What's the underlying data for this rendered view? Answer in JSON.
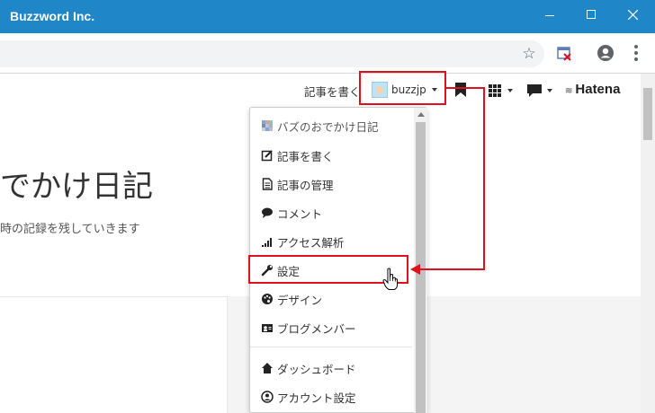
{
  "window": {
    "title": "Buzzword Inc."
  },
  "browser": {
    "icons": [
      "star-icon",
      "extension-icon",
      "profile-icon",
      "menu-icon"
    ]
  },
  "page": {
    "blog_title": "でかけ日記",
    "blog_description": "時の記録を残していきます"
  },
  "hatena_bar": {
    "write_label": "記事を書く",
    "user_name": "buzzjp",
    "logo_text": "Hatena",
    "icons": [
      "bookmark-icon",
      "grid-icon",
      "comment-icon",
      "hatena-logo"
    ]
  },
  "dropdown": {
    "items": [
      {
        "label": "バズのおでかけ日記",
        "icon": "blog-icon"
      },
      {
        "label": "記事を書く",
        "icon": "edit-icon"
      },
      {
        "label": "記事の管理",
        "icon": "document-icon"
      },
      {
        "label": "コメント",
        "icon": "comment-icon"
      },
      {
        "label": "アクセス解析",
        "icon": "signal-icon"
      },
      {
        "label": "設定",
        "icon": "wrench-icon"
      },
      {
        "label": "デザイン",
        "icon": "palette-icon"
      },
      {
        "label": "ブログメンバー",
        "icon": "members-icon"
      },
      {
        "label": "ダッシュボード",
        "icon": "home-icon"
      },
      {
        "label": "アカウント設定",
        "icon": "account-icon"
      }
    ]
  },
  "colors": {
    "titlebar": "#1f86c8",
    "highlight": "#e0101c"
  }
}
